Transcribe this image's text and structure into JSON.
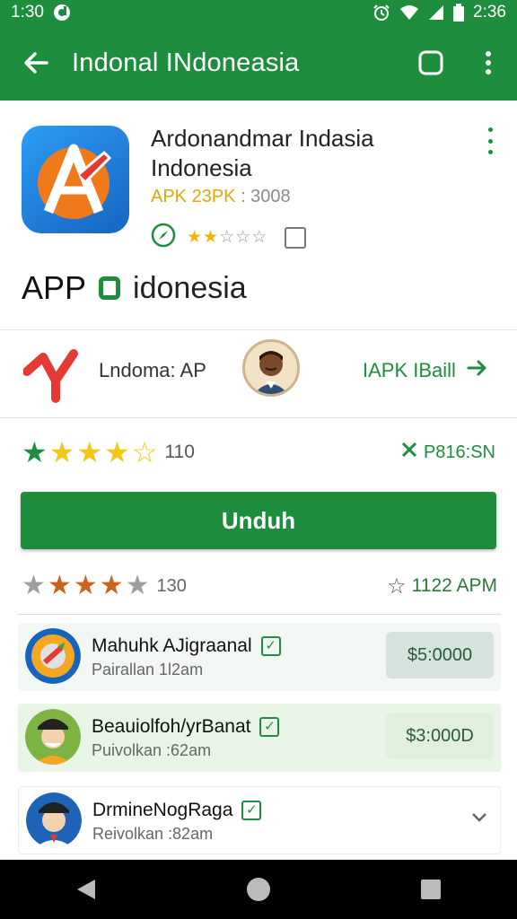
{
  "status_bar": {
    "time_left": "1:30",
    "time_right": "2:36",
    "icons": [
      "notification-icon",
      "alarm-icon",
      "wifi-icon",
      "signal-icon",
      "battery-icon"
    ]
  },
  "app_bar": {
    "title": "Indonal INdoneasia",
    "icons": [
      "back-arrow-icon",
      "square-icon",
      "more-vert-icon"
    ]
  },
  "app": {
    "name": "Ardonandmar Indasia Indonesia",
    "meta_apk": "APK 23PK",
    "meta_rest": " : 3008",
    "label": "APP",
    "label_sub": "idonesia",
    "small_stars": [
      "★",
      "★",
      "☆",
      "☆",
      "☆"
    ]
  },
  "developer": {
    "name": "Lndoma: AP",
    "link": "IAPK IBaill"
  },
  "rating": {
    "count": "110",
    "right_text": "P816:SN"
  },
  "install": {
    "label": "Unduh"
  },
  "rating2": {
    "count": "130",
    "time": "1122 APM"
  },
  "list": [
    {
      "title": "Mahuhk AJigraanal",
      "subtitle": "Pairallan 1l2am",
      "price": "$5:0000"
    },
    {
      "title": "Beauiolfoh/yrBanat",
      "subtitle": "Puivolkan :62am",
      "price": "$3:000D"
    },
    {
      "title": "DrmineNogRaga",
      "subtitle": "Reivolkan :82am",
      "price": ""
    }
  ],
  "colors": {
    "primary": "#1e8e3e",
    "star_gold": "#f5c518",
    "star_green": "#1e8e3e",
    "star_orange": "#c8641e",
    "star_gray": "#9e9e9e"
  }
}
